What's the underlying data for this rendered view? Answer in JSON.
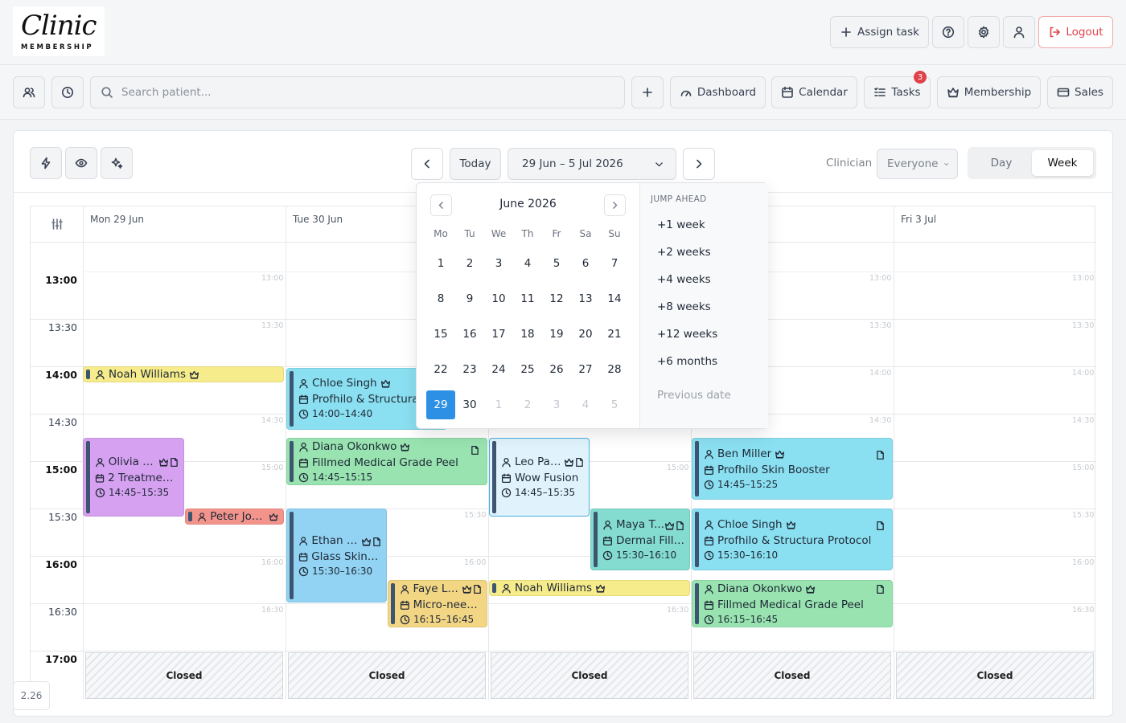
{
  "header": {
    "logo_script": "Clinic",
    "logo_sub": "MEMBERSHIP",
    "assign_task": "Assign task",
    "logout": "Logout"
  },
  "toolbar": {
    "search_placeholder": "Search patient...",
    "dashboard": "Dashboard",
    "calendar": "Calendar",
    "tasks": "Tasks",
    "tasks_badge": "3",
    "membership": "Membership",
    "sales": "Sales"
  },
  "calendar_head": {
    "today": "Today",
    "range": "29 Jun – 5 Jul 2026",
    "clinician_label": "Clinician",
    "clinician_value": "Everyone",
    "view_day": "Day",
    "view_week": "Week",
    "active_view": "Week"
  },
  "days": [
    {
      "label": "Mon 29 Jun"
    },
    {
      "label": "Tue 30 Jun"
    },
    {
      "label": ""
    },
    {
      "label": ""
    },
    {
      "label": "Fri 3 Jul"
    }
  ],
  "times": [
    "13:00",
    "13:30",
    "14:00",
    "14:30",
    "15:00",
    "15:30",
    "16:00",
    "16:30",
    "17:00"
  ],
  "closed_label": "Closed",
  "events": {
    "noah1": {
      "name": "Noah Williams"
    },
    "chloe1": {
      "name": "Chloe Singh",
      "service": "Profhilo & Structura",
      "time": "14:00–14:40"
    },
    "olivia": {
      "name": "Olivia B...",
      "service": "2 Treatment...",
      "time": "14:45–15:35"
    },
    "diana1": {
      "name": "Diana Okonkwo",
      "service": "Fillmed Medical Grade Peel",
      "time": "14:45–15:15"
    },
    "leo": {
      "name": "Leo Pat...",
      "service": "Wow Fusion",
      "time": "14:45–15:35"
    },
    "ben": {
      "name": "Ben Miller",
      "service": "Profhilo Skin Booster",
      "time": "14:45–15:25"
    },
    "peter": {
      "name": "Peter Jon..."
    },
    "ethan": {
      "name": "Ethan B...",
      "service": "Glass Skin F...",
      "time": "15:30–16:30"
    },
    "maya": {
      "name": "Maya T...",
      "service": "Dermal Filler",
      "time": "15:30–16:10"
    },
    "chloe2": {
      "name": "Chloe Singh",
      "service": "Profhilo & Structura Protocol",
      "time": "15:30–16:10"
    },
    "faye": {
      "name": "Faye La...",
      "service": "Micro-need...",
      "time": "16:15–16:45"
    },
    "noah2": {
      "name": "Noah Williams"
    },
    "diana2": {
      "name": "Diana Okonkwo",
      "service": "Fillmed Medical Grade Peel",
      "time": "16:15–16:45"
    }
  },
  "datepicker": {
    "month": "June 2026",
    "weekdays": [
      "Mo",
      "Tu",
      "We",
      "Th",
      "Fr",
      "Sa",
      "Su"
    ],
    "weeks": [
      [
        "1",
        "2",
        "3",
        "4",
        "5",
        "6",
        "7"
      ],
      [
        "8",
        "9",
        "10",
        "11",
        "12",
        "13",
        "14"
      ],
      [
        "15",
        "16",
        "17",
        "18",
        "19",
        "20",
        "21"
      ],
      [
        "22",
        "23",
        "24",
        "25",
        "26",
        "27",
        "28"
      ],
      [
        "29",
        "30",
        "1",
        "2",
        "3",
        "4",
        "5"
      ]
    ],
    "selected": "29",
    "jump_title": "JUMP AHEAD",
    "jump": [
      "+1 week",
      "+2 weeks",
      "+4 weeks",
      "+8 weeks",
      "+12 weeks",
      "+6 months"
    ],
    "previous": "Previous date"
  },
  "version": "2.26"
}
